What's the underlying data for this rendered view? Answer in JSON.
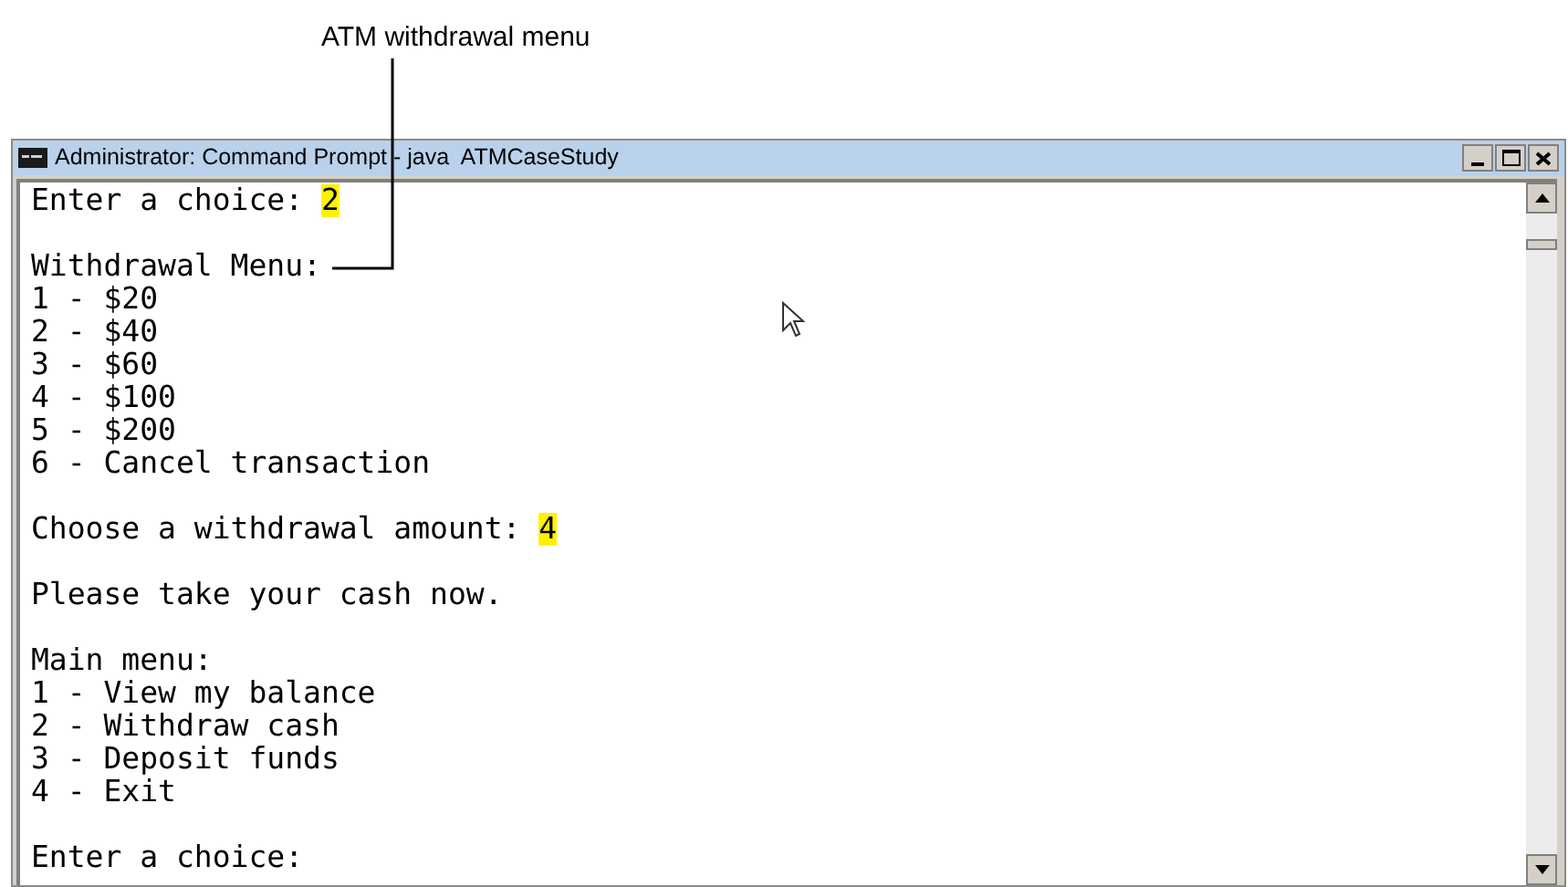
{
  "annotation": {
    "label": "ATM withdrawal menu"
  },
  "window": {
    "title": "Administrator: Command Prompt - java  ATMCaseStudy"
  },
  "console_lines": [
    {
      "kind": "prompt",
      "text": "Enter a choice: ",
      "input": "2"
    },
    {
      "kind": "blank"
    },
    {
      "kind": "text",
      "text": "Withdrawal Menu:"
    },
    {
      "kind": "text",
      "text": "1 - $20"
    },
    {
      "kind": "text",
      "text": "2 - $40"
    },
    {
      "kind": "text",
      "text": "3 - $60"
    },
    {
      "kind": "text",
      "text": "4 - $100"
    },
    {
      "kind": "text",
      "text": "5 - $200"
    },
    {
      "kind": "text",
      "text": "6 - Cancel transaction"
    },
    {
      "kind": "blank"
    },
    {
      "kind": "prompt",
      "text": "Choose a withdrawal amount: ",
      "input": "4"
    },
    {
      "kind": "blank"
    },
    {
      "kind": "text",
      "text": "Please take your cash now."
    },
    {
      "kind": "blank"
    },
    {
      "kind": "text",
      "text": "Main menu:"
    },
    {
      "kind": "text",
      "text": "1 - View my balance"
    },
    {
      "kind": "text",
      "text": "2 - Withdraw cash"
    },
    {
      "kind": "text",
      "text": "3 - Deposit funds"
    },
    {
      "kind": "text",
      "text": "4 - Exit"
    },
    {
      "kind": "blank"
    },
    {
      "kind": "text",
      "text": "Enter a choice:"
    }
  ]
}
